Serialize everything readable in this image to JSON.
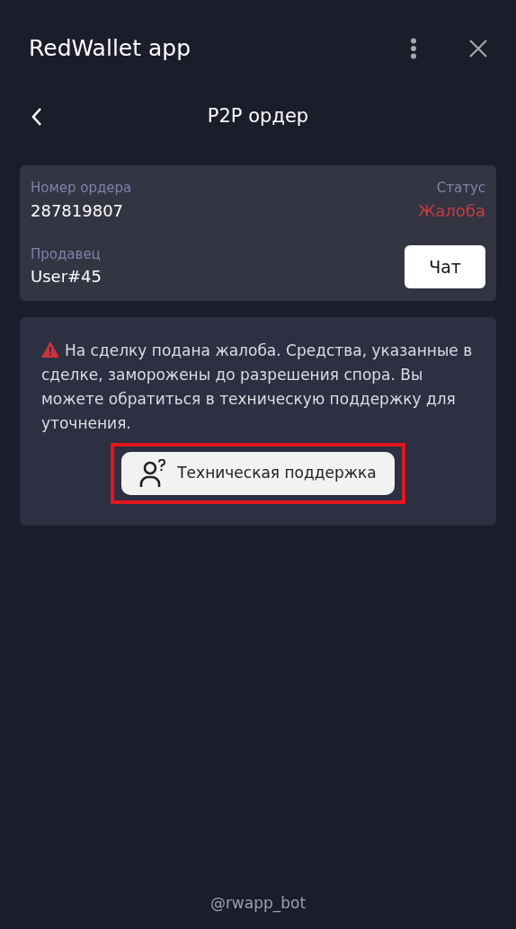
{
  "window": {
    "title": "RedWallet app"
  },
  "page": {
    "title": "P2P ордер"
  },
  "order": {
    "number_label": "Номер ордера",
    "number": "287819807",
    "status_label": "Статус",
    "status": "Жалоба",
    "seller_label": "Продавец",
    "seller": "User#45",
    "chat_button": "Чат"
  },
  "notice": {
    "text": "На сделку подана жалоба. Средства, указанные в сделке, заморожены до разрешения спора. Вы можете обратиться в техническую поддержку для уточнения.",
    "support_button": {
      "label": "Техническая поддержка",
      "highlighted": true
    }
  },
  "footer": "@rwapp_bot"
}
